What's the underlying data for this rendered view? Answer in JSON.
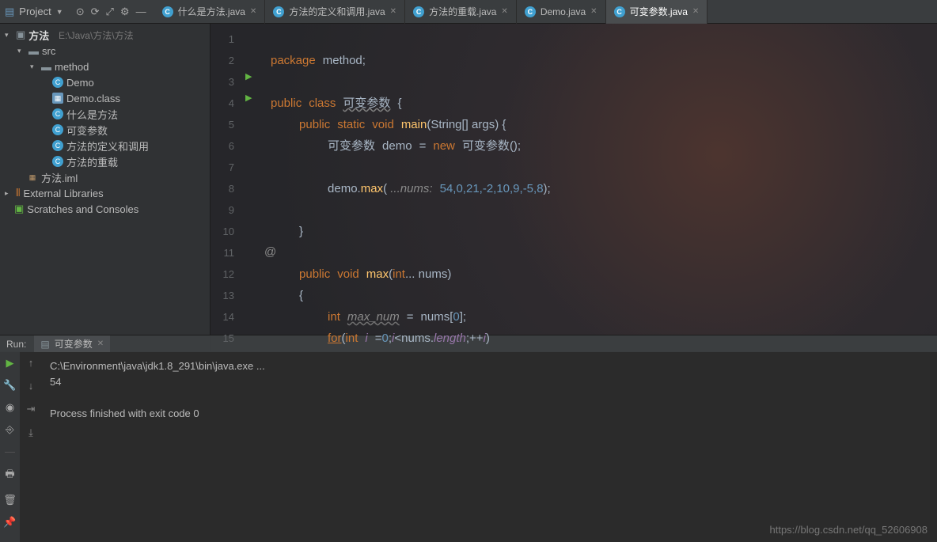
{
  "topbar": {
    "project_label": "Project",
    "icons": {
      "target": "⊙",
      "refresh": "⟳",
      "collapse": "⤢",
      "settings": "⚙",
      "minimize": "—"
    }
  },
  "tabs": [
    {
      "label": "什么是方法.java",
      "active": false
    },
    {
      "label": "方法的定义和调用.java",
      "active": false
    },
    {
      "label": "方法的重载.java",
      "active": false
    },
    {
      "label": "Demo.java",
      "active": false
    },
    {
      "label": "可变参数.java",
      "active": true
    }
  ],
  "tree": {
    "root": {
      "name": "方法",
      "path": "E:\\Java\\方法\\方法"
    },
    "src": "src",
    "pkg": "method",
    "files": [
      "Demo",
      "Demo.class",
      "什么是方法",
      "可变参数",
      "方法的定义和调用",
      "方法的重载"
    ],
    "iml": "方法.iml",
    "ext": "External Libraries",
    "scratch": "Scratches and Consoles"
  },
  "code": {
    "lines": [
      "1",
      "2",
      "3",
      "4",
      "5",
      "6",
      "7",
      "8",
      "9",
      "10",
      "11",
      "12",
      "13",
      "14",
      "15"
    ],
    "l1_pkg": "package",
    "l1_name": "method",
    "l3_pub": "public",
    "l3_cls": "class",
    "l3_name": "可变参数",
    "l4_pub": "public",
    "l4_sta": "static",
    "l4_void": "void",
    "l4_main": "main",
    "l4_str": "String",
    "l4_args": "args",
    "l5_t": "可变参数",
    "l5_demo": "demo",
    "l5_new": "new",
    "l5_t2": "可变参数",
    "l7_demo": "demo",
    "l7_max": "max",
    "l7_hint": "...nums:",
    "l7_args": "54,0,21,-2,10,9,-5,8",
    "l11_pub": "public",
    "l11_void": "void",
    "l11_max": "max",
    "l11_int": "int",
    "l11_nums": "nums",
    "l13_int": "int",
    "l13_mn": "max_num",
    "l13_nums": "nums",
    "l13_idx": "0",
    "l14_for": "for",
    "l14_int": "int",
    "l14_i": "i",
    "l14_z": "0",
    "l14_i2": "i",
    "l14_nums": "nums",
    "l14_len": "length",
    "l14_i3": "i"
  },
  "run": {
    "label": "Run:",
    "tab": "可变参数",
    "out1": "C:\\Environment\\java\\jdk1.8_291\\bin\\java.exe ...",
    "out2": "54",
    "out3": "Process finished with exit code 0"
  },
  "watermark": "https://blog.csdn.net/qq_52606908"
}
